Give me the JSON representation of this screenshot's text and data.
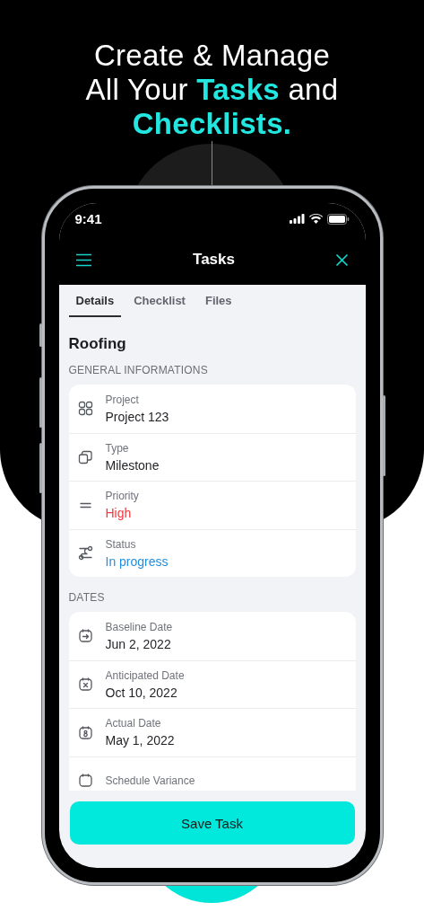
{
  "headline": [
    [
      {
        "text": "Create & Manage",
        "highlight": false
      }
    ],
    [
      {
        "text": "All Your ",
        "highlight": false
      },
      {
        "text": "Tasks",
        "highlight": true
      },
      {
        "text": " and",
        "highlight": false
      }
    ],
    [
      {
        "text": "Checklists.",
        "highlight": true
      }
    ]
  ],
  "status_bar": {
    "time": "9:41"
  },
  "nav": {
    "title": "Tasks"
  },
  "tabs": [
    {
      "label": "Details",
      "selected": true
    },
    {
      "label": "Checklist",
      "selected": false
    },
    {
      "label": "Files",
      "selected": false
    }
  ],
  "title": "Roofing",
  "sections": [
    {
      "heading": "GENERAL INFORMATIONS",
      "rows": [
        {
          "kind": "grid",
          "label": "Project",
          "value": "Project 123",
          "color": "#1f2024"
        },
        {
          "kind": "copy",
          "label": "Type",
          "value": "Milestone",
          "color": "#1f2024"
        },
        {
          "kind": "equals",
          "label": "Priority",
          "value": "High",
          "color": "#f0383f"
        },
        {
          "kind": "route",
          "label": "Status",
          "value": "In progress",
          "color": "#1f8ee0"
        }
      ]
    },
    {
      "heading": "DATES",
      "rows": [
        {
          "kind": "arrowdate",
          "label": "Baseline Date",
          "value": "Jun 2, 2022",
          "color": "#1f2024"
        },
        {
          "kind": "crossdate",
          "label": "Anticipated Date",
          "value": "Oct 10, 2022",
          "color": "#1f2024"
        },
        {
          "kind": "dotdate",
          "label": "Actual Date",
          "value": "May 1, 2022",
          "color": "#1f2024"
        },
        {
          "kind": "date",
          "label": "Schedule Variance"
        }
      ]
    }
  ],
  "save_button": "Save Task"
}
